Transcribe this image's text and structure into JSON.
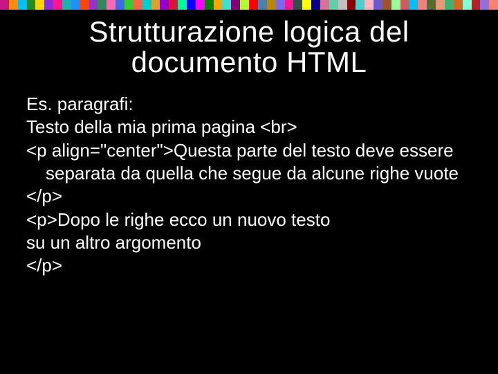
{
  "stripe_colors": [
    "#c71585",
    "#ff8c00",
    "#00bfff",
    "#228b22",
    "#ffd700",
    "#8a2be2",
    "#ff1493",
    "#20b2aa",
    "#1e90ff",
    "#ff4500",
    "#9932cc",
    "#2e8b57",
    "#ff69b4",
    "#4169e1",
    "#32cd32",
    "#ff6347",
    "#00ced1",
    "#daa520",
    "#9400d3",
    "#dc143c",
    "#00fa9a",
    "#0000ff",
    "#ff00ff",
    "#008000",
    "#ffa500",
    "#40e0d0",
    "#800080",
    "#adff2f",
    "#ff0000",
    "#4682b4",
    "#b8860b",
    "#7b68ee",
    "#ff1493",
    "#2f4f4f",
    "#ffff00",
    "#00008b",
    "#db7093",
    "#66cdaa",
    "#c0c0c0",
    "#8b0000",
    "#48d1cc",
    "#ffb6c1",
    "#6a5acd",
    "#a0522d",
    "#98fb98",
    "#cd5c5c",
    "#00bfff",
    "#f08080",
    "#556b2f",
    "#e9967a",
    "#3cb371",
    "#d2691e",
    "#7fffd4",
    "#b22222",
    "#9370db",
    "#fa8072"
  ],
  "title_line1": "Strutturazione logica del",
  "title_line2": "documento HTML",
  "body": {
    "l1": "Es. paragrafi:",
    "l2": "Testo della mia prima pagina <br>",
    "l3": "<p align=\"center\">Questa parte del testo deve essere separata da quella che segue da alcune righe vuote",
    "l4": "</p>",
    "l5": "<p>Dopo le righe ecco un nuovo testo",
    "l6": "su un altro argomento",
    "l7": "</p>"
  }
}
